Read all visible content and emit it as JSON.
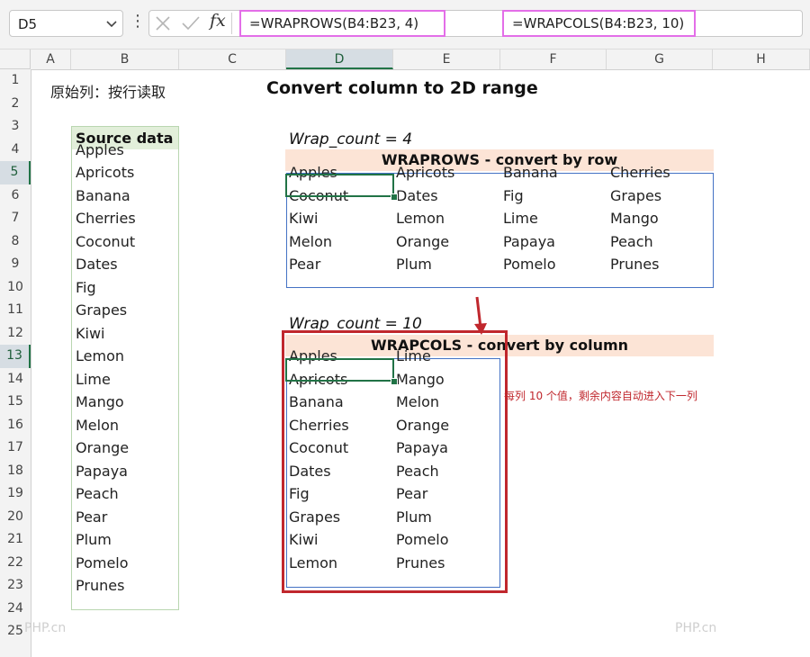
{
  "formula_bar": {
    "namebox": "D5",
    "dots": "⋮",
    "fx": "fx",
    "formula_wraprows": "=WRAPROWS(B4:B23, 4)",
    "formula_wrapcols": "=WRAPCOLS(B4:B23, 10)"
  },
  "columns": [
    "A",
    "B",
    "C",
    "D",
    "E",
    "F",
    "G",
    "H"
  ],
  "selected_column": "D",
  "rows": [
    "1",
    "2",
    "3",
    "4",
    "5",
    "6",
    "7",
    "8",
    "9",
    "10",
    "11",
    "12",
    "13",
    "14",
    "15",
    "16",
    "17",
    "18",
    "19",
    "20",
    "21",
    "22",
    "23",
    "24",
    "25"
  ],
  "selected_rows": [
    "5",
    "13"
  ],
  "sheet": {
    "note": "原始列：按行读取",
    "title": "Convert column to 2D range",
    "source_header": "Source data",
    "source_values": [
      "Apples",
      "Apricots",
      "Banana",
      "Cherries",
      "Coconut",
      "Dates",
      "Fig",
      "Grapes",
      "Kiwi",
      "Lemon",
      "Lime",
      "Mango",
      "Melon",
      "Orange",
      "Papaya",
      "Peach",
      "Pear",
      "Plum",
      "Pomelo",
      "Prunes"
    ],
    "wraprows": {
      "label": "Wrap_count = 4",
      "header": "WRAPROWS - convert by row",
      "rows": [
        [
          "Apples",
          "Apricots",
          "Banana",
          "Cherries"
        ],
        [
          "Coconut",
          "Dates",
          "Fig",
          "Grapes"
        ],
        [
          "Kiwi",
          "Lemon",
          "Lime",
          "Mango"
        ],
        [
          "Melon",
          "Orange",
          "Papaya",
          "Peach"
        ],
        [
          "Pear",
          "Plum",
          "Pomelo",
          "Prunes"
        ]
      ]
    },
    "wrapcols": {
      "label": "Wrap_count = 10",
      "header": "WRAPCOLS - convert by column",
      "columns": [
        [
          "Apples",
          "Apricots",
          "Banana",
          "Cherries",
          "Coconut",
          "Dates",
          "Fig",
          "Grapes",
          "Kiwi",
          "Lemon"
        ],
        [
          "Lime",
          "Mango",
          "Melon",
          "Orange",
          "Papaya",
          "Peach",
          "Pear",
          "Plum",
          "Pomelo",
          "Prunes"
        ]
      ]
    },
    "annotation": "每列 10 个值，剩余内容自动进入下一列"
  },
  "watermarks": [
    "PHP.cn",
    "PHP.cn"
  ],
  "colors": {
    "accent_green": "#217346",
    "source_header_fill": "#e2efda",
    "table_header_fill": "#fce4d6",
    "table_border": "#4472c4",
    "formula_highlight": "#e36ee8",
    "annotation_red": "#c0272d"
  }
}
